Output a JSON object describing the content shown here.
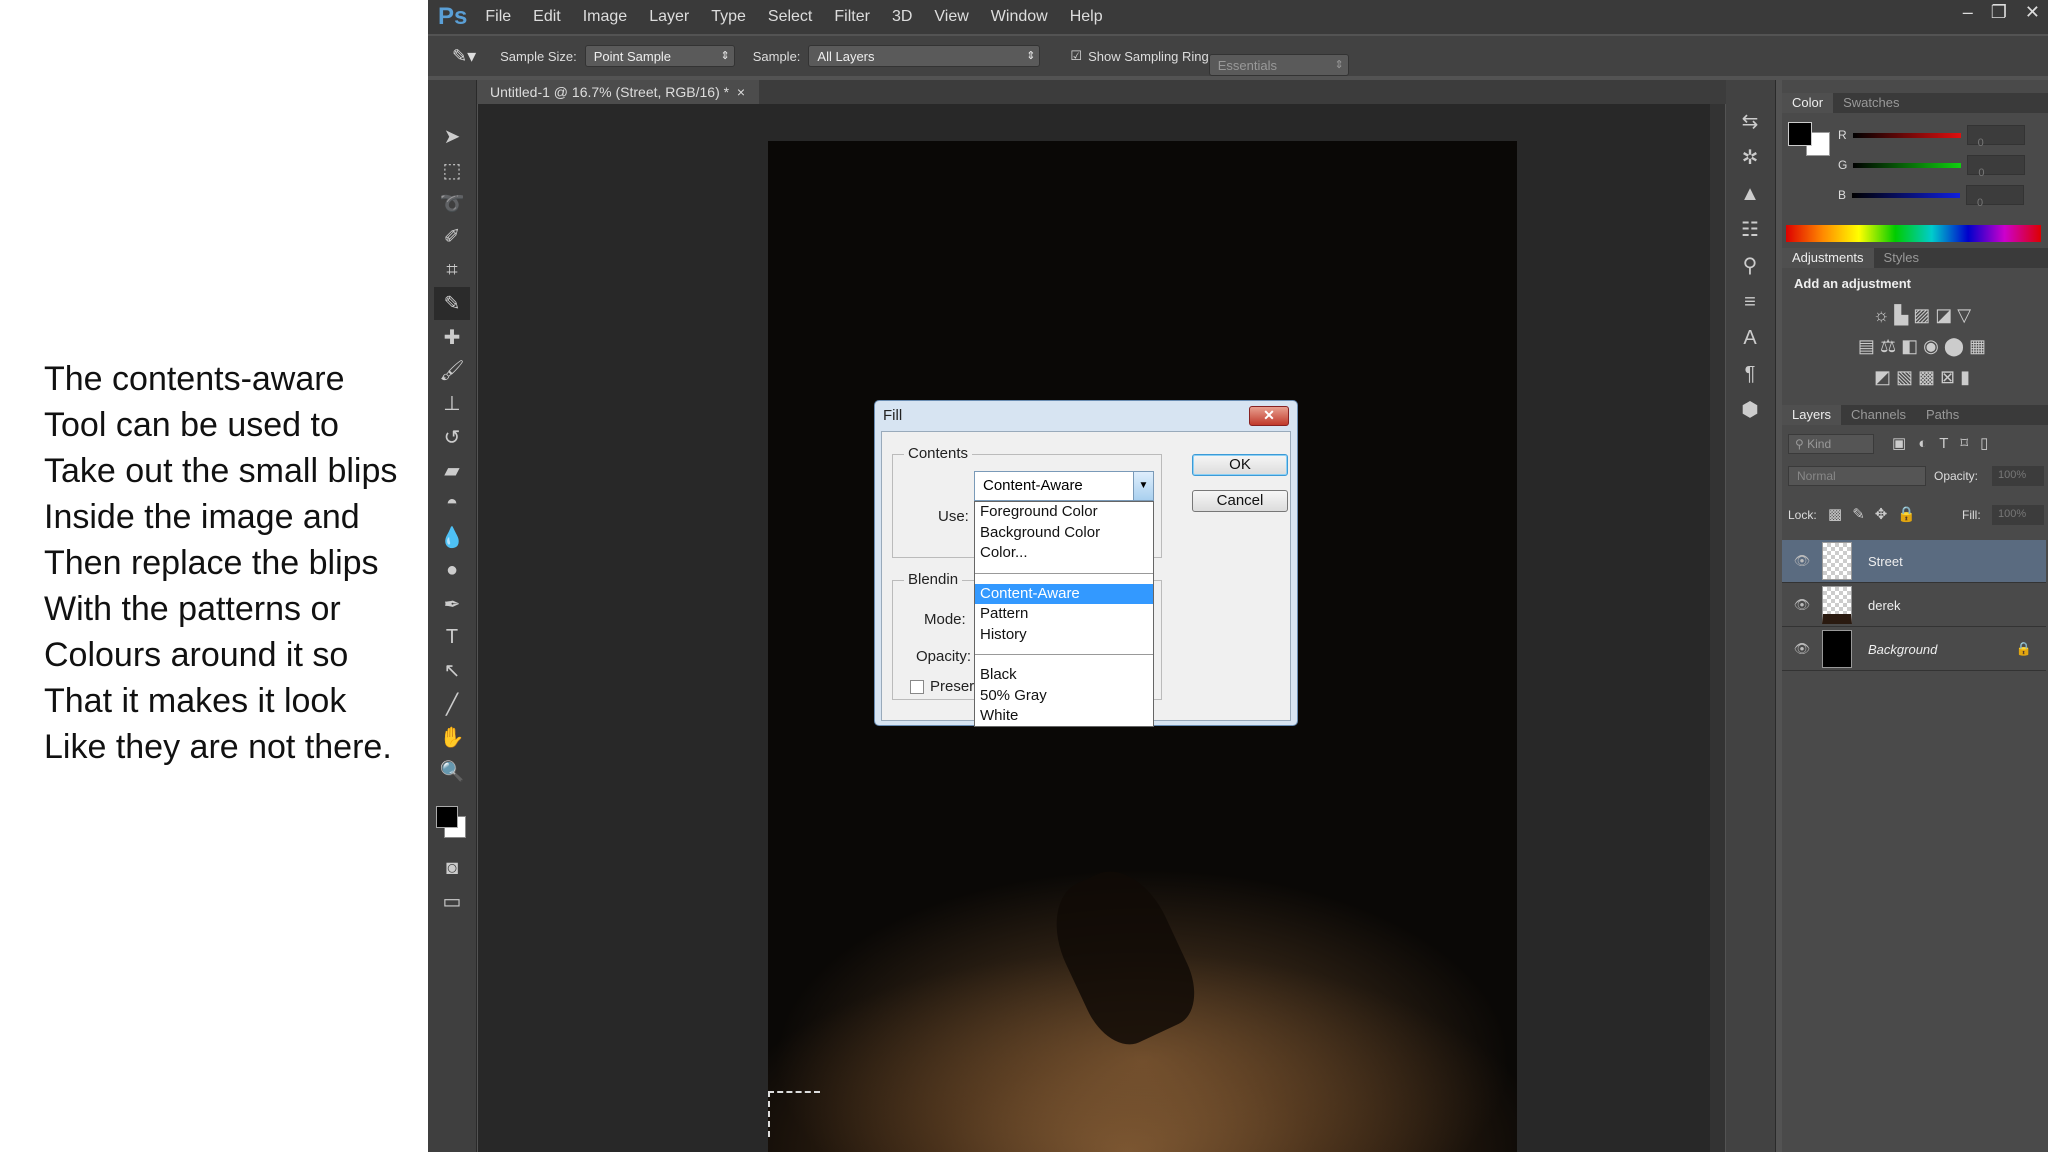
{
  "caption": [
    "The contents-aware",
    "Tool can be used to",
    "Take out the small blips",
    "Inside the image and",
    "Then replace the blips",
    "With the patterns or",
    "Colours around it so",
    "That it makes it look",
    "Like they are not there."
  ],
  "app": {
    "logo": "Ps",
    "menu": [
      "File",
      "Edit",
      "Image",
      "Layer",
      "Type",
      "Select",
      "Filter",
      "3D",
      "View",
      "Window",
      "Help"
    ],
    "workspace": "Essentials"
  },
  "options": {
    "sample_size_label": "Sample Size:",
    "sample_size": "Point Sample",
    "sample_label": "Sample:",
    "sample": "All Layers",
    "show_ring": "Show Sampling Ring"
  },
  "document": {
    "tab": "Untitled-1 @ 16.7% (Street, RGB/16) *"
  },
  "color_panel": {
    "tabs": [
      "Color",
      "Swatches"
    ],
    "channels": [
      {
        "label": "R",
        "value": "0",
        "color": "#e01010"
      },
      {
        "label": "G",
        "value": "0",
        "color": "#10d010"
      },
      {
        "label": "B",
        "value": "0",
        "color": "#1020e0"
      }
    ]
  },
  "adjustments": {
    "tabs": [
      "Adjustments",
      "Styles"
    ],
    "heading": "Add an adjustment"
  },
  "layers_panel": {
    "tabs": [
      "Layers",
      "Channels",
      "Paths"
    ],
    "kind": "Kind",
    "mode": "Normal",
    "opacity_label": "Opacity:",
    "opacity": "100%",
    "lock_label": "Lock:",
    "fill_label": "Fill:",
    "fill": "100%",
    "layers": [
      {
        "name": "Street",
        "selected": true
      },
      {
        "name": "derek",
        "selected": false
      },
      {
        "name": "Background",
        "selected": false
      }
    ]
  },
  "fill_dialog": {
    "title": "Fill",
    "contents_label": "Contents",
    "use_label": "Use:",
    "use_value": "Content-Aware",
    "blending_label": "Blendin",
    "mode_label": "Mode:",
    "opacity_label": "Opacity:",
    "preserve_label": "Preserv",
    "ok": "OK",
    "cancel": "Cancel",
    "options_group1": [
      "Foreground Color",
      "Background Color",
      "Color..."
    ],
    "options_group2": [
      "Content-Aware",
      "Pattern",
      "History"
    ],
    "options_group3": [
      "Black",
      "50% Gray",
      "White"
    ]
  }
}
